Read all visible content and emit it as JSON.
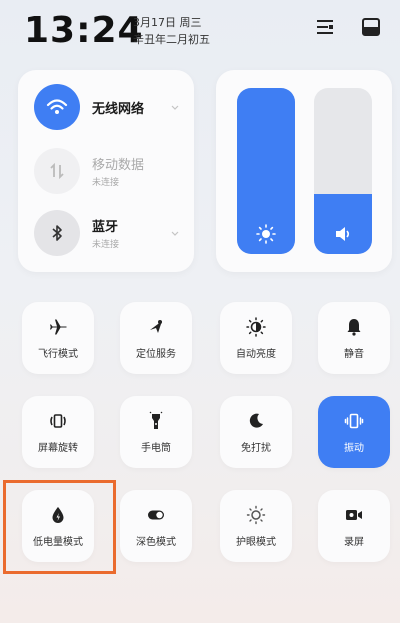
{
  "status": {
    "time": "13:24",
    "date_line1": "3月17日 周三",
    "date_line2": "辛丑年二月初五"
  },
  "header_icons": [
    "list-edit-icon",
    "inbox-icon"
  ],
  "connectivity": {
    "wifi": {
      "label": "无线网络",
      "sub": ""
    },
    "mobile_data": {
      "label": "移动数据",
      "sub": "未连接"
    },
    "bluetooth": {
      "label": "蓝牙",
      "sub": "未连接"
    }
  },
  "sliders": {
    "brightness": {
      "level": 1.0,
      "icon": "brightness-icon"
    },
    "volume": {
      "level": 0.36,
      "icon": "volume-icon"
    }
  },
  "tiles": [
    {
      "label": "飞行模式",
      "icon": "airplane-icon",
      "active": false
    },
    {
      "label": "定位服务",
      "icon": "location-icon",
      "active": false
    },
    {
      "label": "自动亮度",
      "icon": "auto-brightness-icon",
      "active": false
    },
    {
      "label": "静音",
      "icon": "bell-icon",
      "active": false
    },
    {
      "label": "屏幕旋转",
      "icon": "rotate-icon",
      "active": false
    },
    {
      "label": "手电筒",
      "icon": "flashlight-icon",
      "active": false
    },
    {
      "label": "免打扰",
      "icon": "moon-icon",
      "active": false
    },
    {
      "label": "振动",
      "icon": "vibrate-icon",
      "active": true
    },
    {
      "label": "低电量模式",
      "icon": "battery-saver-icon",
      "active": false
    },
    {
      "label": "深色模式",
      "icon": "dark-mode-icon",
      "active": false
    },
    {
      "label": "护眼模式",
      "icon": "eye-comfort-icon",
      "active": false
    },
    {
      "label": "录屏",
      "icon": "screen-record-icon",
      "active": false
    }
  ],
  "colors": {
    "accent": "#3f7ef3",
    "highlight": "#ea6b2e"
  }
}
